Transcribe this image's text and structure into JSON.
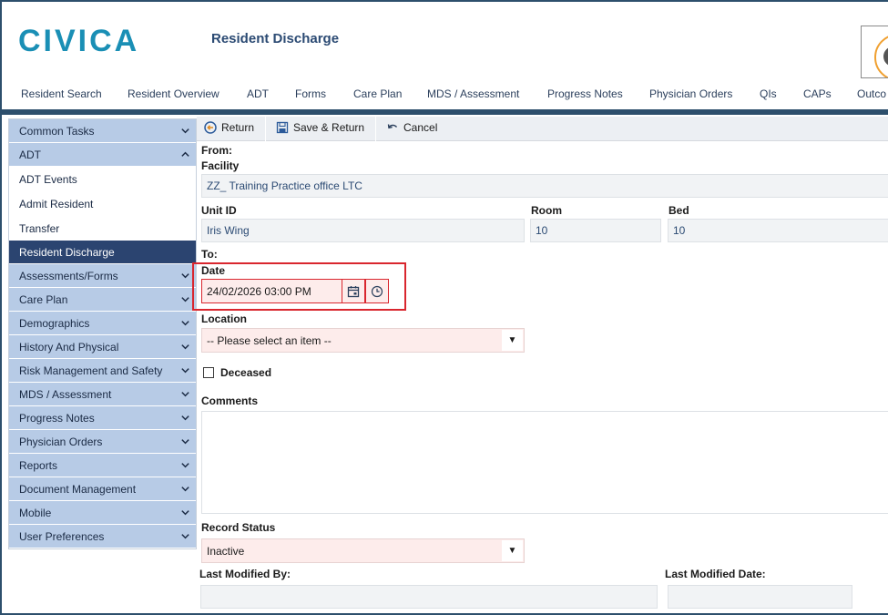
{
  "header": {
    "logo_text": "CIVICA",
    "page_title": "Resident Discharge"
  },
  "topnav": [
    "Resident Search",
    "Resident Overview",
    "ADT",
    "Forms",
    "Care Plan",
    "MDS / Assessment",
    "Progress Notes",
    "Physician Orders",
    "QIs",
    "CAPs",
    "Outco"
  ],
  "sidebar": {
    "common_tasks": "Common Tasks",
    "adt": "ADT",
    "adt_events": "ADT Events",
    "admit_resident": "Admit Resident",
    "transfer": "Transfer",
    "resident_discharge": "Resident Discharge",
    "assessments_forms": "Assessments/Forms",
    "care_plan": "Care Plan",
    "demographics": "Demographics",
    "history_physical": "History And Physical",
    "risk_management": "Risk Management and Safety",
    "mds_assessment": "MDS / Assessment",
    "progress_notes": "Progress Notes",
    "physician_orders": "Physician Orders",
    "reports": "Reports",
    "document_management": "Document Management",
    "mobile": "Mobile",
    "user_preferences": "User Preferences"
  },
  "toolbar": {
    "return_label": "Return",
    "save_return_label": "Save & Return",
    "cancel_label": "Cancel"
  },
  "form": {
    "from_label": "From:",
    "facility_label": "Facility",
    "facility_value": "ZZ_ Training Practice office LTC",
    "unit_id_label": "Unit ID",
    "unit_id_value": "Iris Wing",
    "room_label": "Room",
    "room_value": "10",
    "bed_label": "Bed",
    "bed_value": "10",
    "to_label": "To:",
    "date_label": "Date",
    "date_value": "24/02/2026 03:00 PM",
    "location_label": "Location",
    "location_value": "-- Please select an item --",
    "deceased_label": "Deceased",
    "comments_label": "Comments",
    "record_status_label": "Record Status",
    "record_status_value": "Inactive",
    "last_modified_by_label": "Last Modified By:",
    "last_modified_by_value": "",
    "last_modified_date_label": "Last Modified Date:",
    "last_modified_date_value": ""
  },
  "colors": {
    "brand": "#1a8fb5",
    "nav_bar": "#2d4f6c",
    "sidebar_group": "#b7cbe6",
    "sidebar_active": "#2b4470",
    "required_bg": "#fdeceb",
    "highlight": "#d9262e"
  },
  "icons": {
    "return": "return-circle-icon",
    "save_return": "save-icon",
    "cancel": "undo-icon",
    "calendar": "calendar-icon",
    "clock": "clock-icon",
    "dropdown": "caret-down-icon",
    "chevron": "chevron-icon"
  }
}
